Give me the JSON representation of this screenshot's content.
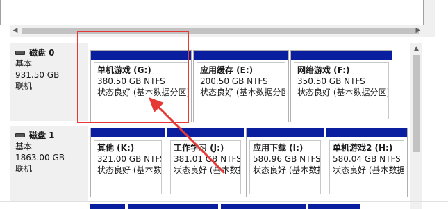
{
  "disks": [
    {
      "name": "磁盘 0",
      "type": "基本",
      "size": "931.50 GB",
      "status": "联机",
      "partitions": [
        {
          "label": "单机游戏  (G:)",
          "size": "380.50 GB NTFS",
          "status": "状态良好 (基本数据分区)"
        },
        {
          "label": "应用缓存  (E:)",
          "size": "200.50 GB NTFS",
          "status": "状态良好 (基本数据分区)"
        },
        {
          "label": "网络游戏  (F:)",
          "size": "350.50 GB NTFS",
          "status": "状态良好 (基本数据分区)"
        }
      ]
    },
    {
      "name": "磁盘 1",
      "type": "基本",
      "size": "1863.00 GB",
      "status": "联机",
      "partitions": [
        {
          "label": "其他  (K:)",
          "size": "321.00 GB NTFS",
          "status": "状态良好 (基本数据"
        },
        {
          "label": "工作学习  (J:)",
          "size": "381.01 GB NTFS",
          "status": "状态良好 (基本数据"
        },
        {
          "label": "应用下载  (I:)",
          "size": "580.96 GB NTFS",
          "status": "状态良好 (基本数据"
        },
        {
          "label": "单机游戏2  (H:)",
          "size": "580.04 GB NTFS",
          "status": "状态良好 (基本数据"
        }
      ]
    }
  ],
  "colors": {
    "primary_partition_band": "#0a1ea0",
    "annotation": "#e53935"
  },
  "icons": {
    "disk": "disk-icon",
    "scroll_left": "arrow-left-icon",
    "scroll_right": "arrow-right-icon",
    "scroll_up": "arrow-up-icon"
  }
}
